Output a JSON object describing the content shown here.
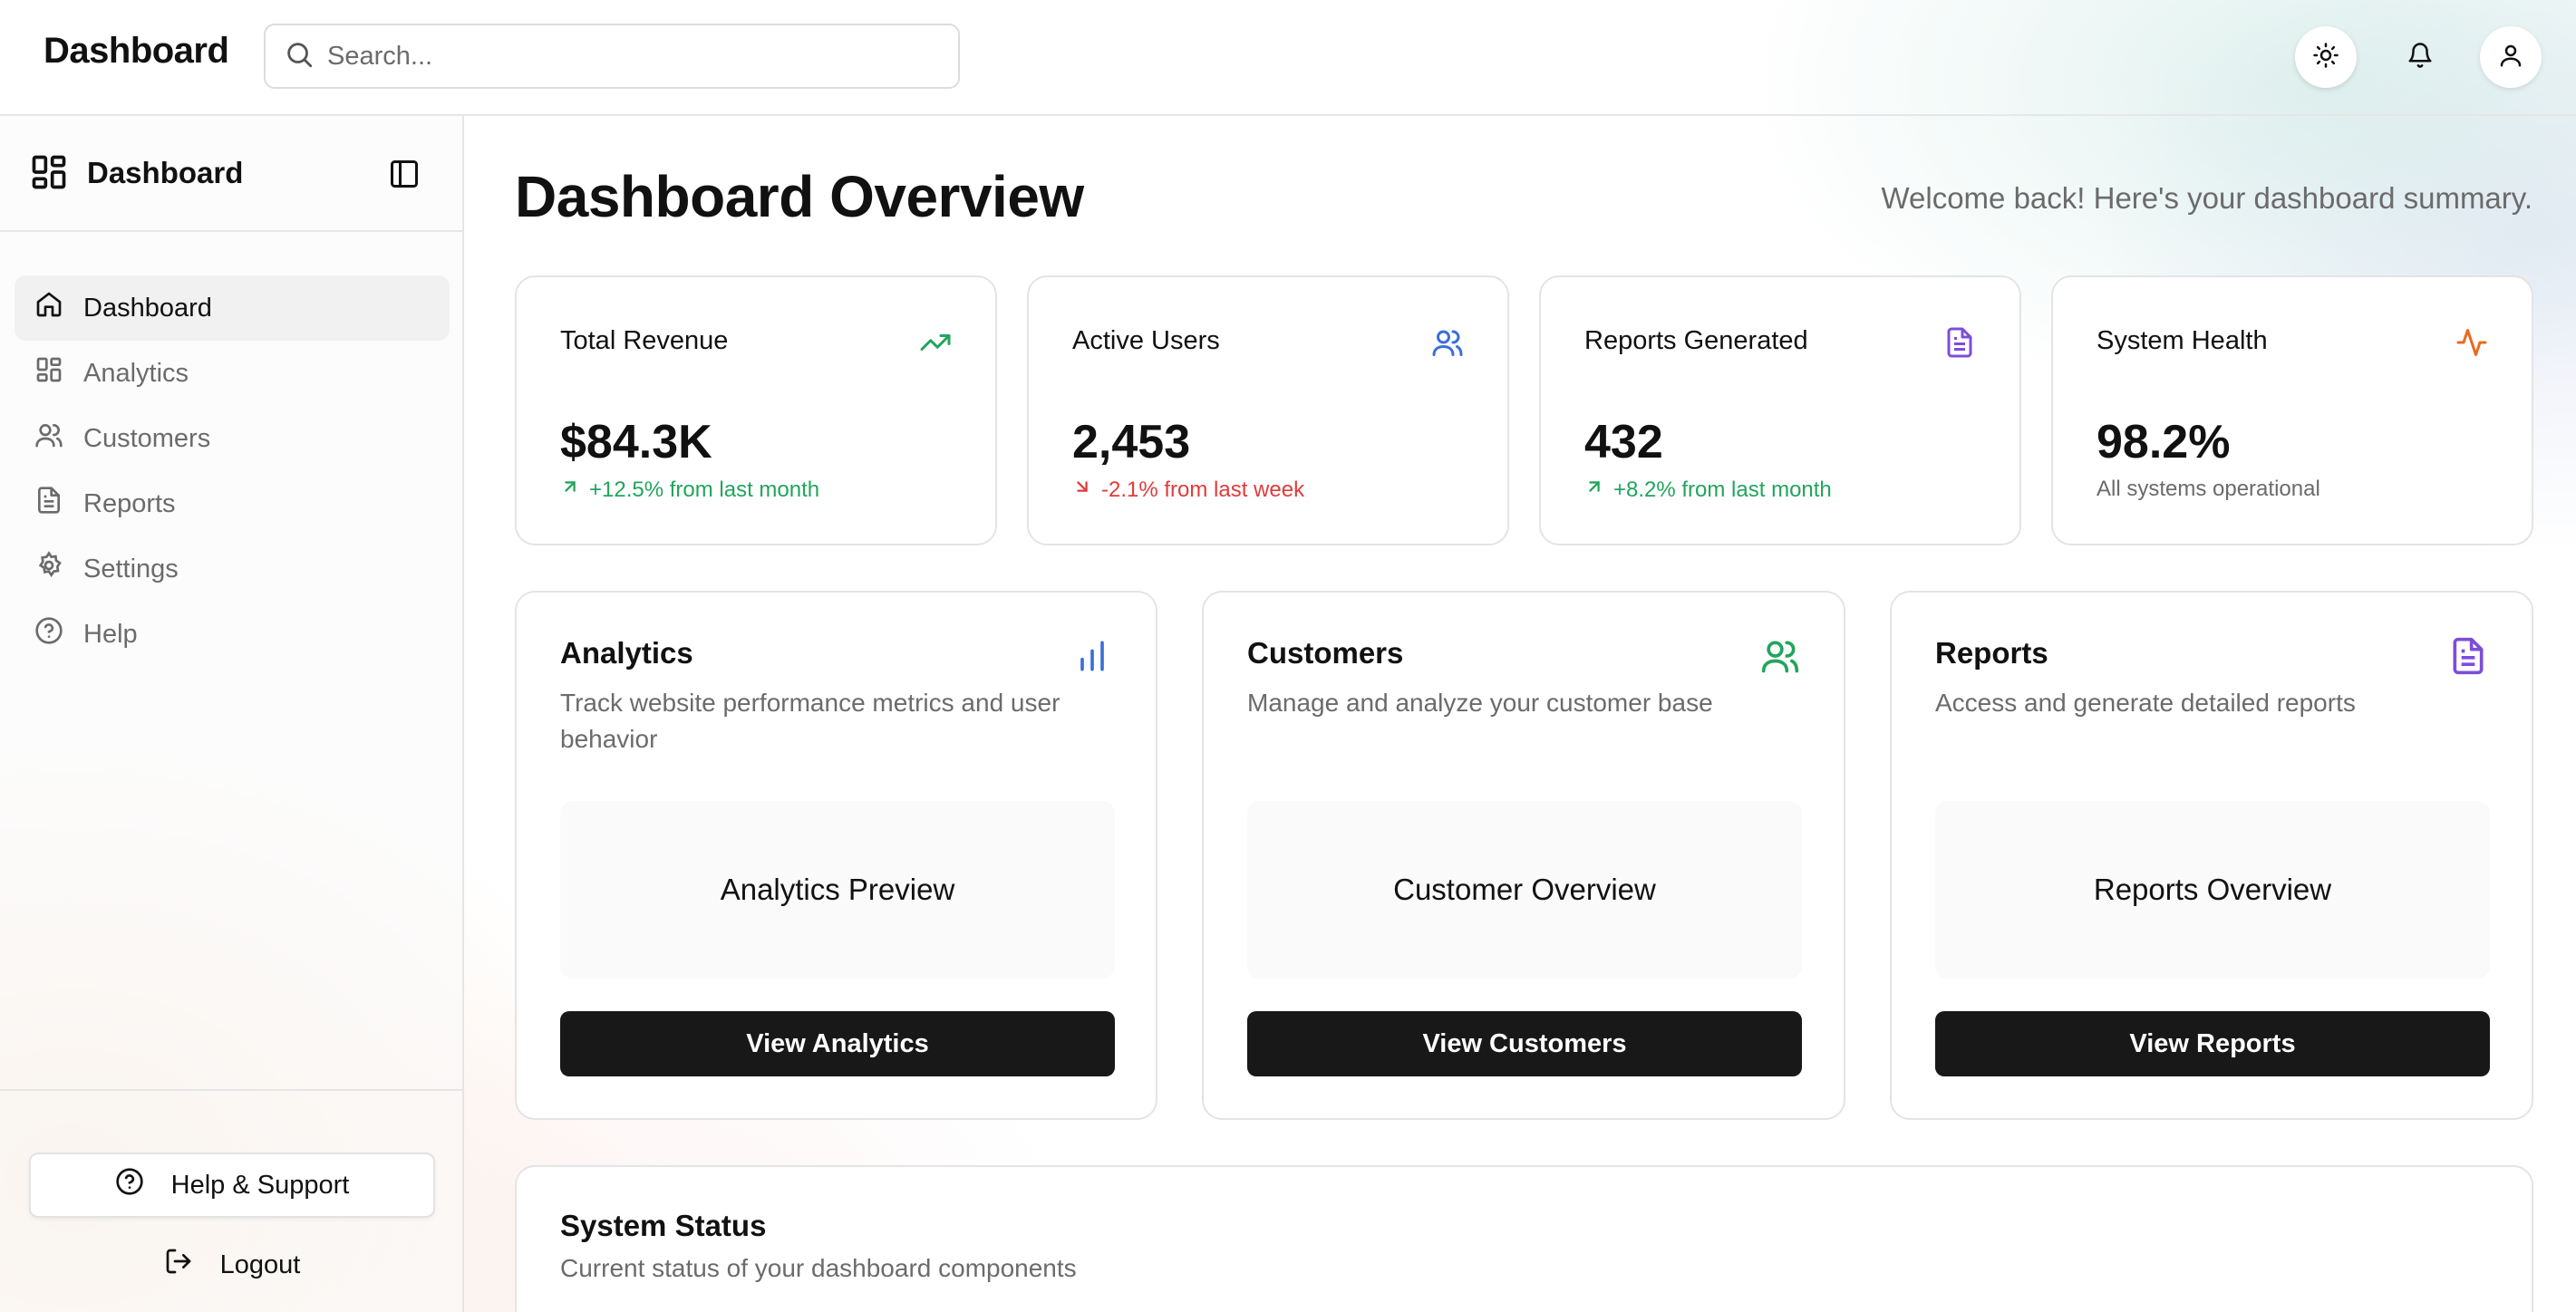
{
  "header": {
    "app_title": "Dashboard",
    "search_placeholder": "Search...",
    "icons": [
      "sun-icon",
      "bell-icon",
      "user-icon"
    ]
  },
  "sidebar": {
    "title": "Dashboard",
    "items": [
      {
        "label": "Dashboard",
        "icon": "home-icon",
        "active": true
      },
      {
        "label": "Analytics",
        "icon": "grid-icon",
        "active": false
      },
      {
        "label": "Customers",
        "icon": "users-icon",
        "active": false
      },
      {
        "label": "Reports",
        "icon": "file-icon",
        "active": false
      },
      {
        "label": "Settings",
        "icon": "gear-icon",
        "active": false
      },
      {
        "label": "Help",
        "icon": "help-circle-icon",
        "active": false
      }
    ],
    "help_support_label": "Help & Support",
    "logout_label": "Logout"
  },
  "main": {
    "title": "Dashboard Overview",
    "welcome": "Welcome back! Here's your dashboard summary.",
    "stats": [
      {
        "label": "Total Revenue",
        "value": "$84.3K",
        "change": "+12.5% from last month",
        "trend": "up",
        "icon": "trending-up-icon",
        "color": "#22a45d"
      },
      {
        "label": "Active Users",
        "value": "2,453",
        "change": "-2.1% from last week",
        "trend": "down",
        "icon": "users-icon",
        "color": "#3b6fd6"
      },
      {
        "label": "Reports Generated",
        "value": "432",
        "change": "+8.2% from last month",
        "trend": "up",
        "icon": "file-icon",
        "color": "#7c4ddb"
      },
      {
        "label": "System Health",
        "value": "98.2%",
        "change": "All systems operational",
        "trend": "neutral",
        "icon": "activity-icon",
        "color": "#ea6a1f"
      }
    ],
    "features": [
      {
        "title": "Analytics",
        "description": "Track website performance metrics and user behavior",
        "preview": "Analytics Preview",
        "button": "View Analytics",
        "icon": "bar-chart-icon",
        "color": "#3b6fd6"
      },
      {
        "title": "Customers",
        "description": "Manage and analyze your customer base",
        "preview": "Customer Overview",
        "button": "View Customers",
        "icon": "users-icon",
        "color": "#22a45d"
      },
      {
        "title": "Reports",
        "description": "Access and generate detailed reports",
        "preview": "Reports Overview",
        "button": "View Reports",
        "icon": "file-icon",
        "color": "#7c4ddb"
      }
    ],
    "system_status": {
      "title": "System Status",
      "subtitle": "Current status of your dashboard components"
    }
  }
}
